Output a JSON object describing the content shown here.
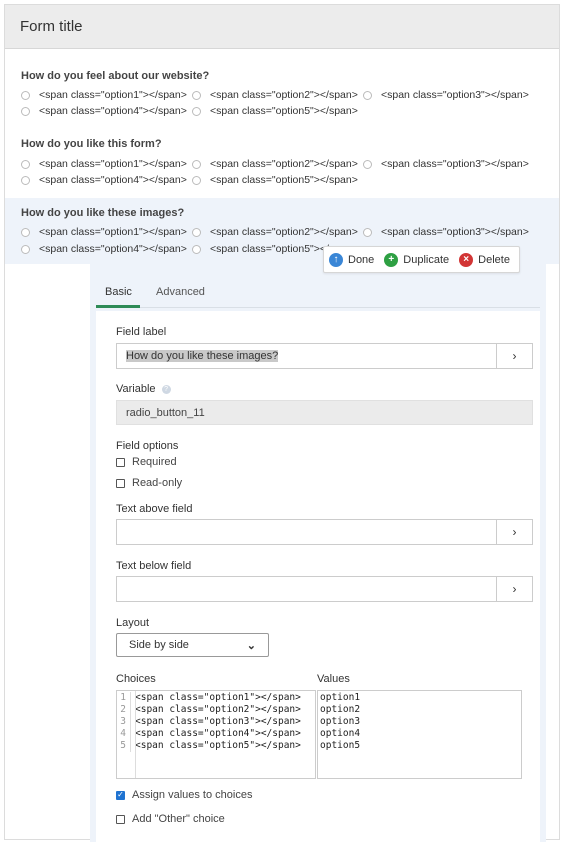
{
  "form": {
    "title": "Form title"
  },
  "questions": [
    {
      "label": "How do you feel about our website?",
      "options": [
        "<span class=\"option1\"></span>",
        "<span class=\"option2\"></span>",
        "<span class=\"option3\"></span>",
        "<span class=\"option4\"></span>",
        "<span class=\"option5\"></span>"
      ]
    },
    {
      "label": "How do you like this form?",
      "options": [
        "<span class=\"option1\"></span>",
        "<span class=\"option2\"></span>",
        "<span class=\"option3\"></span>",
        "<span class=\"option4\"></span>",
        "<span class=\"option5\"></span>"
      ]
    },
    {
      "label": "How do you like these images?",
      "options": [
        "<span class=\"option1\"></span>",
        "<span class=\"option2\"></span>",
        "<span class=\"option3\"></span>",
        "<span class=\"option4\"></span>",
        "<span class=\"option5\"></span>"
      ]
    }
  ],
  "toolbar": {
    "done_label": "Done",
    "duplicate_label": "Duplicate",
    "delete_label": "Delete",
    "colors": {
      "done": "#3a86d6",
      "duplicate": "#2ea043",
      "delete": "#d23535"
    }
  },
  "editor": {
    "tabs": [
      "Basic",
      "Advanced"
    ],
    "active_tab": "Basic",
    "field_label": {
      "label": "Field label",
      "value": "How do you like these images?",
      "button": "›"
    },
    "variable": {
      "label": "Variable",
      "value": "radio_button_11"
    },
    "field_options": {
      "label": "Field options",
      "required": "Required",
      "readonly": "Read-only"
    },
    "text_above": {
      "label": "Text above field",
      "value": "",
      "button": "›"
    },
    "text_below": {
      "label": "Text below field",
      "value": "",
      "button": "›"
    },
    "layout": {
      "label": "Layout",
      "value": "Side by side",
      "arrow": "⌄"
    },
    "choices": {
      "label": "Choices",
      "lines": [
        "<span class=\"option1\"></span>",
        "<span class=\"option2\"></span>",
        "<span class=\"option3\"></span>",
        "<span class=\"option4\"></span>",
        "<span class=\"option5\"></span>"
      ],
      "line_numbers": [
        "1",
        "2",
        "3",
        "4",
        "5"
      ]
    },
    "values": {
      "label": "Values",
      "lines": [
        "option1",
        "option2",
        "option3",
        "option4",
        "option5"
      ]
    },
    "assign_values": {
      "label": "Assign values to choices",
      "checked": true
    },
    "add_other": {
      "label": "Add \"Other\" choice",
      "checked": false
    }
  },
  "colors": {
    "accent_tab": "#2e8b57",
    "active_question_bg": "#eef3fa",
    "checkbox_checked": "#1f73d1"
  }
}
